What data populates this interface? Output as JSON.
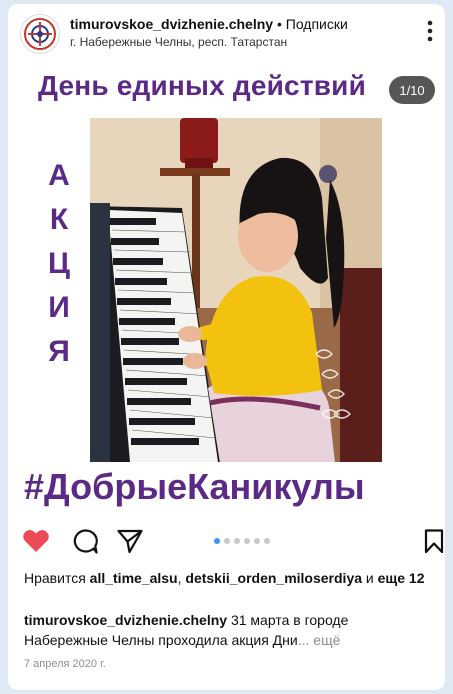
{
  "header": {
    "username": "timurovskoe_dvizhenie.chelny",
    "separator": " • ",
    "follow": "Подписки",
    "location": "г. Набережные Челны, респ. Татарстан"
  },
  "post": {
    "headline": "День единых действий",
    "counter": "1/10",
    "vertical_letters": [
      "А",
      "К",
      "Ц",
      "И",
      "Я"
    ],
    "hashtag": "#ДобрыеКаникулы",
    "carousel": {
      "total": 6,
      "active_index": 0
    }
  },
  "likes": {
    "prefix": "Нравится ",
    "user1": "all_time_alsu",
    "comma": ", ",
    "user2": "detskii_orden_miloserdiya",
    "and": " и ",
    "more": "еще 12"
  },
  "caption": {
    "username": "timurovskoe_dvizhenie.chelny",
    "text": " 31 марта в городе Набережные Челны проходила акция Дни",
    "ellipsis": "... ",
    "more": "ещё"
  },
  "date": "7 апреля 2020 г.",
  "icons": {
    "like": "heart-icon",
    "comment": "comment-icon",
    "share": "send-icon",
    "save": "bookmark-icon",
    "options": "more-vertical-icon"
  },
  "colors": {
    "heart": "#ed4956",
    "headline": "#5b2a86",
    "carousel_active": "#3a97f0"
  }
}
